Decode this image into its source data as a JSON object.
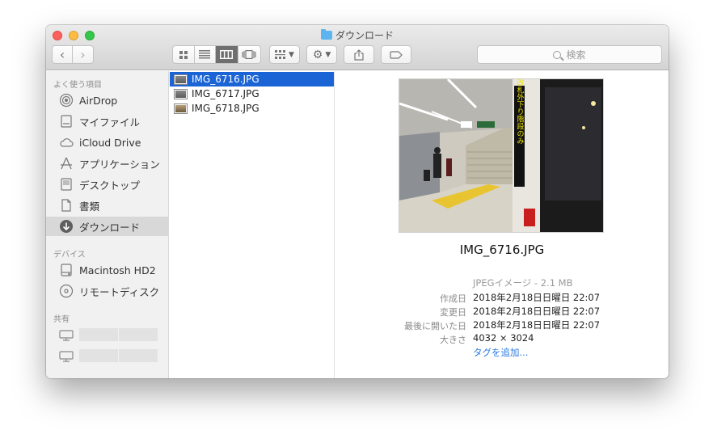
{
  "window": {
    "title": "ダウンロード"
  },
  "toolbar": {
    "back": "‹",
    "forward": "›",
    "views": [
      "icon",
      "list",
      "column",
      "coverflow"
    ],
    "arrange_label": "arrange",
    "action_label": "action",
    "share_label": "share",
    "tag_label": "tag",
    "search_placeholder": "検索"
  },
  "sidebar": {
    "sections": {
      "favorites": "よく使う項目",
      "devices": "デバイス",
      "shared": "共有"
    },
    "favorites": [
      {
        "label": "AirDrop",
        "icon": "airdrop-icon"
      },
      {
        "label": "マイファイル",
        "icon": "all-files-icon"
      },
      {
        "label": "iCloud Drive",
        "icon": "cloud-icon"
      },
      {
        "label": "アプリケーション",
        "icon": "applications-icon"
      },
      {
        "label": "デスクトップ",
        "icon": "desktop-icon"
      },
      {
        "label": "書類",
        "icon": "documents-icon"
      },
      {
        "label": "ダウンロード",
        "icon": "downloads-icon",
        "selected": true
      }
    ],
    "devices": [
      {
        "label": "Macintosh HD2",
        "icon": "harddrive-icon"
      },
      {
        "label": "リモートディスク",
        "icon": "disc-icon"
      }
    ]
  },
  "files": [
    {
      "name": "IMG_6716.JPG",
      "selected": true
    },
    {
      "name": "IMG_6717.JPG",
      "selected": false
    },
    {
      "name": "IMG_6718.JPG",
      "selected": false
    }
  ],
  "preview": {
    "filename": "IMG_6716.JPG",
    "kind": "JPEGイメージ - 2.1 MB",
    "sign_text": "この先南口の改札外下り階段のみ",
    "rows": [
      {
        "label": "作成日",
        "value": "2018年2月18日日曜日 22:07"
      },
      {
        "label": "変更日",
        "value": "2018年2月18日日曜日 22:07"
      },
      {
        "label": "最後に開いた日",
        "value": "2018年2月18日日曜日 22:07"
      },
      {
        "label": "大きさ",
        "value": "4032 × 3024"
      }
    ],
    "add_tags": "タグを追加..."
  }
}
